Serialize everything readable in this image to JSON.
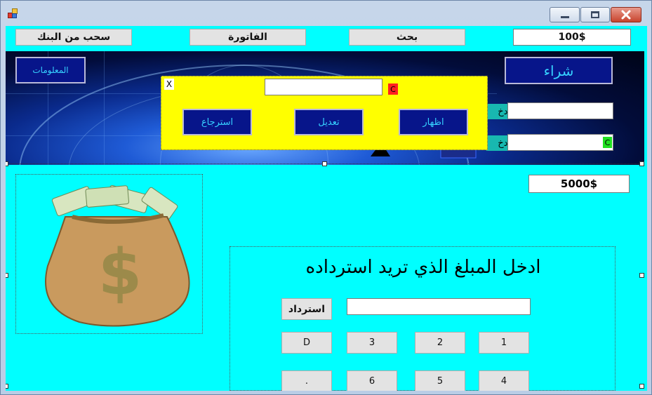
{
  "titlebar": {
    "minimize_label": "",
    "maximize_label": "",
    "close_label": "✕"
  },
  "top_bar": {
    "withdraw_label": "سحب من البنك",
    "invoice_label": "الفاتورة",
    "search_label": "بحث",
    "amount_value": "100$"
  },
  "banner": {
    "info_label": "المعلومات",
    "buy_label": "شراء",
    "field1_label": "ادخ",
    "field2_label": "ادخ",
    "green_c_label": "C"
  },
  "popup": {
    "close_label": "X",
    "clear_label": "C",
    "input_value": "",
    "restore_label": "استرجاع",
    "edit_label": "تعديل",
    "show_label": "اظهار"
  },
  "main": {
    "balance_value": "5000$",
    "refund_title": "ادخل المبلغ الذي تريد استرداده",
    "refund_button_label": "استرداد",
    "refund_input_value": "",
    "keypad": [
      "D",
      "3",
      "2",
      "1",
      ".",
      "6",
      "5",
      "4"
    ]
  },
  "colors": {
    "client_bg": "#00ffff",
    "dark_button_bg": "#07158a",
    "dark_button_text": "#36d1ff",
    "popup_bg": "#ffff00"
  },
  "icons": {
    "app": "app-icon",
    "money_bag": "money-bag-image"
  }
}
